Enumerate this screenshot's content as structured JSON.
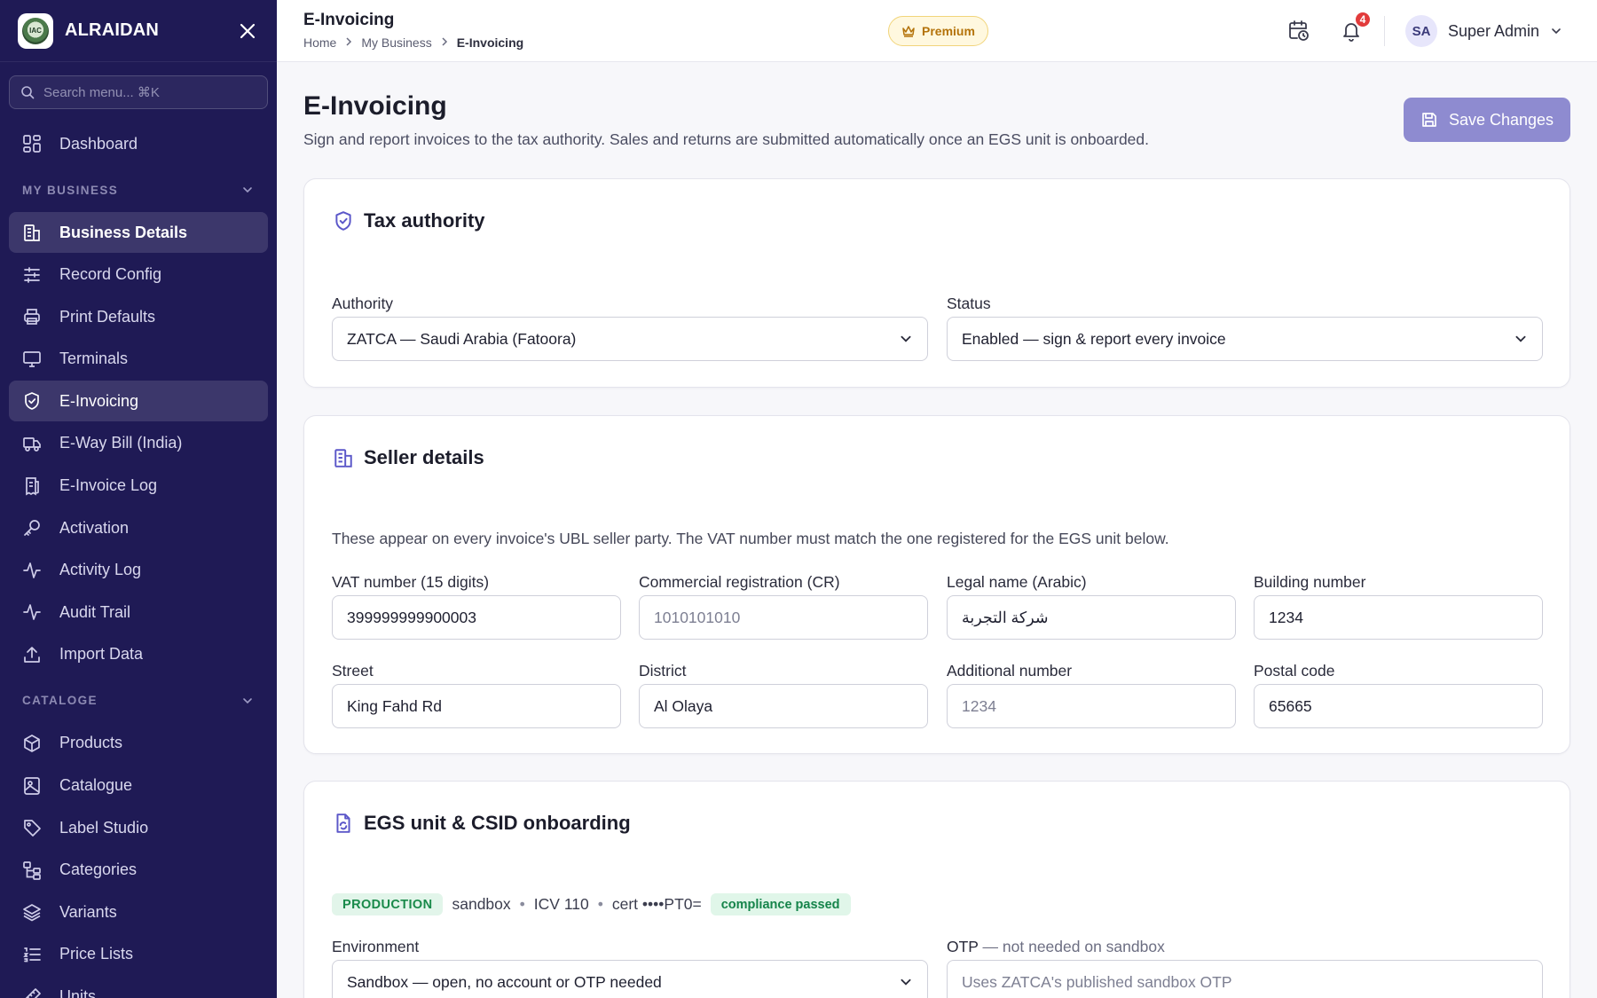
{
  "brand": {
    "name": "ALRAIDAN",
    "logo_text": "IAC"
  },
  "search": {
    "placeholder": "Search menu... ⌘K"
  },
  "nav": {
    "dashboard": "Dashboard",
    "my_business_header": "MY BUSINESS",
    "my_business": [
      "Business Details",
      "Record Config",
      "Print Defaults",
      "Terminals",
      "E-Invoicing",
      "E-Way Bill (India)",
      "E-Invoice Log",
      "Activation",
      "Activity Log",
      "Audit Trail",
      "Import Data"
    ],
    "catalog_header": "CATALOGE",
    "catalog": [
      "Products",
      "Catalogue",
      "Label Studio",
      "Categories",
      "Variants",
      "Price Lists",
      "Units"
    ]
  },
  "topbar": {
    "title": "E-Invoicing",
    "breadcrumb": [
      "Home",
      "My Business",
      "E-Invoicing"
    ],
    "premium_label": "Premium",
    "notification_count": "4",
    "user_initials": "SA",
    "user_name": "Super Admin"
  },
  "page": {
    "title": "E-Invoicing",
    "subtitle": "Sign and report invoices to the tax authority. Sales and returns are submitted automatically once an EGS unit is onboarded.",
    "save_label": "Save Changes"
  },
  "tax_authority": {
    "title": "Tax authority",
    "authority_label": "Authority",
    "authority_value": "ZATCA — Saudi Arabia (Fatoora)",
    "status_label": "Status",
    "status_value": "Enabled — sign & report every invoice"
  },
  "seller": {
    "title": "Seller details",
    "description": "These appear on every invoice's UBL seller party. The VAT number must match the one registered for the EGS unit below.",
    "vat_label": "VAT number (15 digits)",
    "vat_value": "399999999900003",
    "cr_label": "Commercial registration (CR)",
    "cr_placeholder": "1010101010",
    "legal_name_label": "Legal name (Arabic)",
    "legal_name_value": "شركة التجربة",
    "building_label": "Building number",
    "building_value": "1234",
    "street_label": "Street",
    "street_value": "King Fahd Rd",
    "district_label": "District",
    "district_value": "Al Olaya",
    "additional_label": "Additional number",
    "additional_placeholder": "1234",
    "postal_label": "Postal code",
    "postal_value": "65665"
  },
  "egs": {
    "title": "EGS unit & CSID onboarding",
    "tag_env": "PRODUCTION",
    "mode": "sandbox",
    "icv": "ICV 110",
    "cert": "cert ••••PT0=",
    "compliance": "compliance passed",
    "environment_label": "Environment",
    "environment_value": "Sandbox — open, no account or OTP needed",
    "otp_label": "OTP",
    "otp_note": " — not needed on sandbox",
    "otp_placeholder": "Uses ZATCA's published sandbox OTP"
  },
  "colors": {
    "sidebar": "#1f1a55",
    "accent": "#5b57c9",
    "save_button": "#8e8bd0",
    "premium": "#b4730a",
    "badge": "#e23b3b"
  }
}
